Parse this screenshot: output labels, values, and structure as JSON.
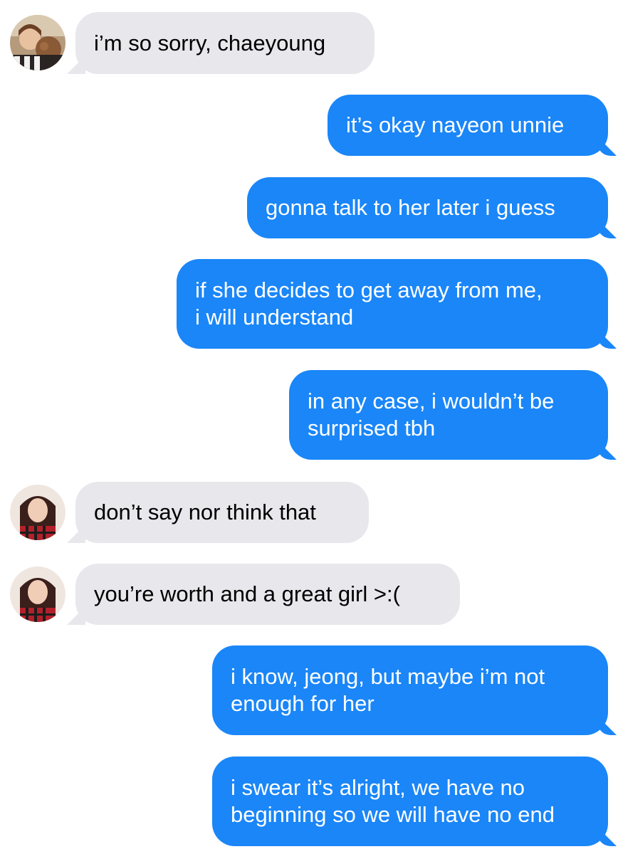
{
  "conversation": {
    "messages": [
      {
        "side": "received",
        "text": "i’m so sorry, chaeyoung",
        "avatar": "avatar-nayeon"
      },
      {
        "side": "sent",
        "text": "it’s okay nayeon unnie"
      },
      {
        "side": "sent",
        "text": "gonna talk to her later i guess"
      },
      {
        "side": "sent",
        "text": "if she decides to get away from me,\ni will understand"
      },
      {
        "side": "sent",
        "text": "in any case, i wouldn’t be\nsurprised tbh"
      },
      {
        "side": "received",
        "text": "don’t say nor think that",
        "avatar": "avatar-jeongyeon"
      },
      {
        "side": "received",
        "text": "you’re worth and a great girl >:(",
        "avatar": "avatar-jeongyeon"
      },
      {
        "side": "sent",
        "text": "i know, jeong, but maybe i’m not\nenough for her"
      },
      {
        "side": "sent",
        "text": "i swear it’s alright, we have no\nbeginning so we will have no end"
      }
    ]
  },
  "colors": {
    "sent_bubble": "#1a86f8",
    "received_bubble": "#e7e7ec",
    "background": "#ffffff"
  }
}
